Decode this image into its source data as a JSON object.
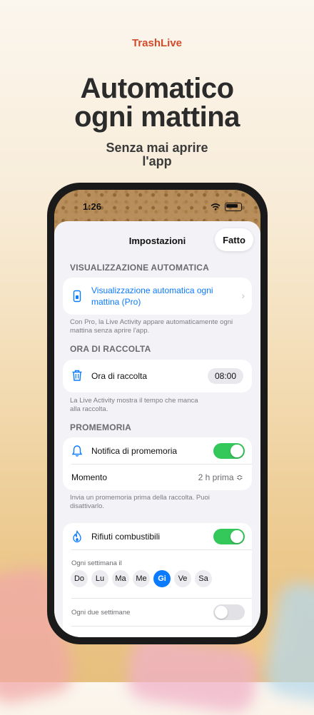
{
  "promo": {
    "brand": "TrashLive",
    "headline_line1": "Automatico",
    "headline_line2": "ogni mattina",
    "sub_line1": "Senza mai aprire",
    "sub_line2": "l'app"
  },
  "status": {
    "time": "1:26"
  },
  "sheet": {
    "title": "Impostazioni",
    "done": "Fatto"
  },
  "auto_display": {
    "header": "VISUALIZZAZIONE AUTOMATICA",
    "label_line1": "Visualizzazione automatica ogni",
    "label_line2": "mattina (Pro)",
    "footnote_line1": "Con Pro, la Live Activity appare automaticamente ogni",
    "footnote_line2": "mattina senza aprire l'app.",
    "icon": "phone-icon"
  },
  "collection": {
    "header": "ORA DI RACCOLTA",
    "label": "Ora di raccolta",
    "value": "08:00",
    "footnote_line1": "La Live Activity mostra il tempo che manca",
    "footnote_line2": "alla raccolta.",
    "icon": "trash-icon"
  },
  "reminder": {
    "header": "PROMEMORIA",
    "label": "Notifica di promemoria",
    "enabled": true,
    "moment_label": "Momento",
    "moment_value": "2 h prima ≎",
    "footnote_line1": "Invia un promemoria prima della raccolta. Puoi",
    "footnote_line2": "disattivarlo.",
    "icon": "bell-icon"
  },
  "waste": {
    "label": "Rifiuti combustibili",
    "enabled": true,
    "weekly_label": "Ogni settimana il",
    "days": [
      "Do",
      "Lu",
      "Ma",
      "Me",
      "Gi",
      "Ve",
      "Sa"
    ],
    "selected_day": "Gi",
    "biweekly_label": "Ogni due settimane",
    "biweekly_enabled": false,
    "icon": "flame-icon"
  },
  "colors": {
    "accent": "#0a7aff",
    "toggle_on": "#34c759",
    "brand": "#d24b2a"
  }
}
